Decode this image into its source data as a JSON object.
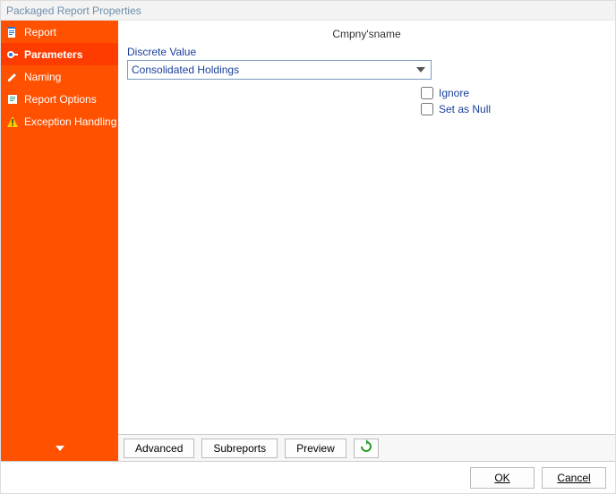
{
  "window": {
    "title": "Packaged Report Properties"
  },
  "sidebar": {
    "items": [
      {
        "label": "Report"
      },
      {
        "label": "Parameters"
      },
      {
        "label": "Naming"
      },
      {
        "label": "Report Options"
      },
      {
        "label": "Exception Handling"
      }
    ]
  },
  "main": {
    "title": "Cmpny'sname",
    "field_label": "Discrete Value",
    "selected_value": "Consolidated Holdings",
    "ignore_label": "Ignore",
    "setnull_label": "Set as Null"
  },
  "toolbar": {
    "advanced": "Advanced",
    "subreports": "Subreports",
    "preview": "Preview"
  },
  "footer": {
    "ok": "OK",
    "cancel": "Cancel"
  }
}
